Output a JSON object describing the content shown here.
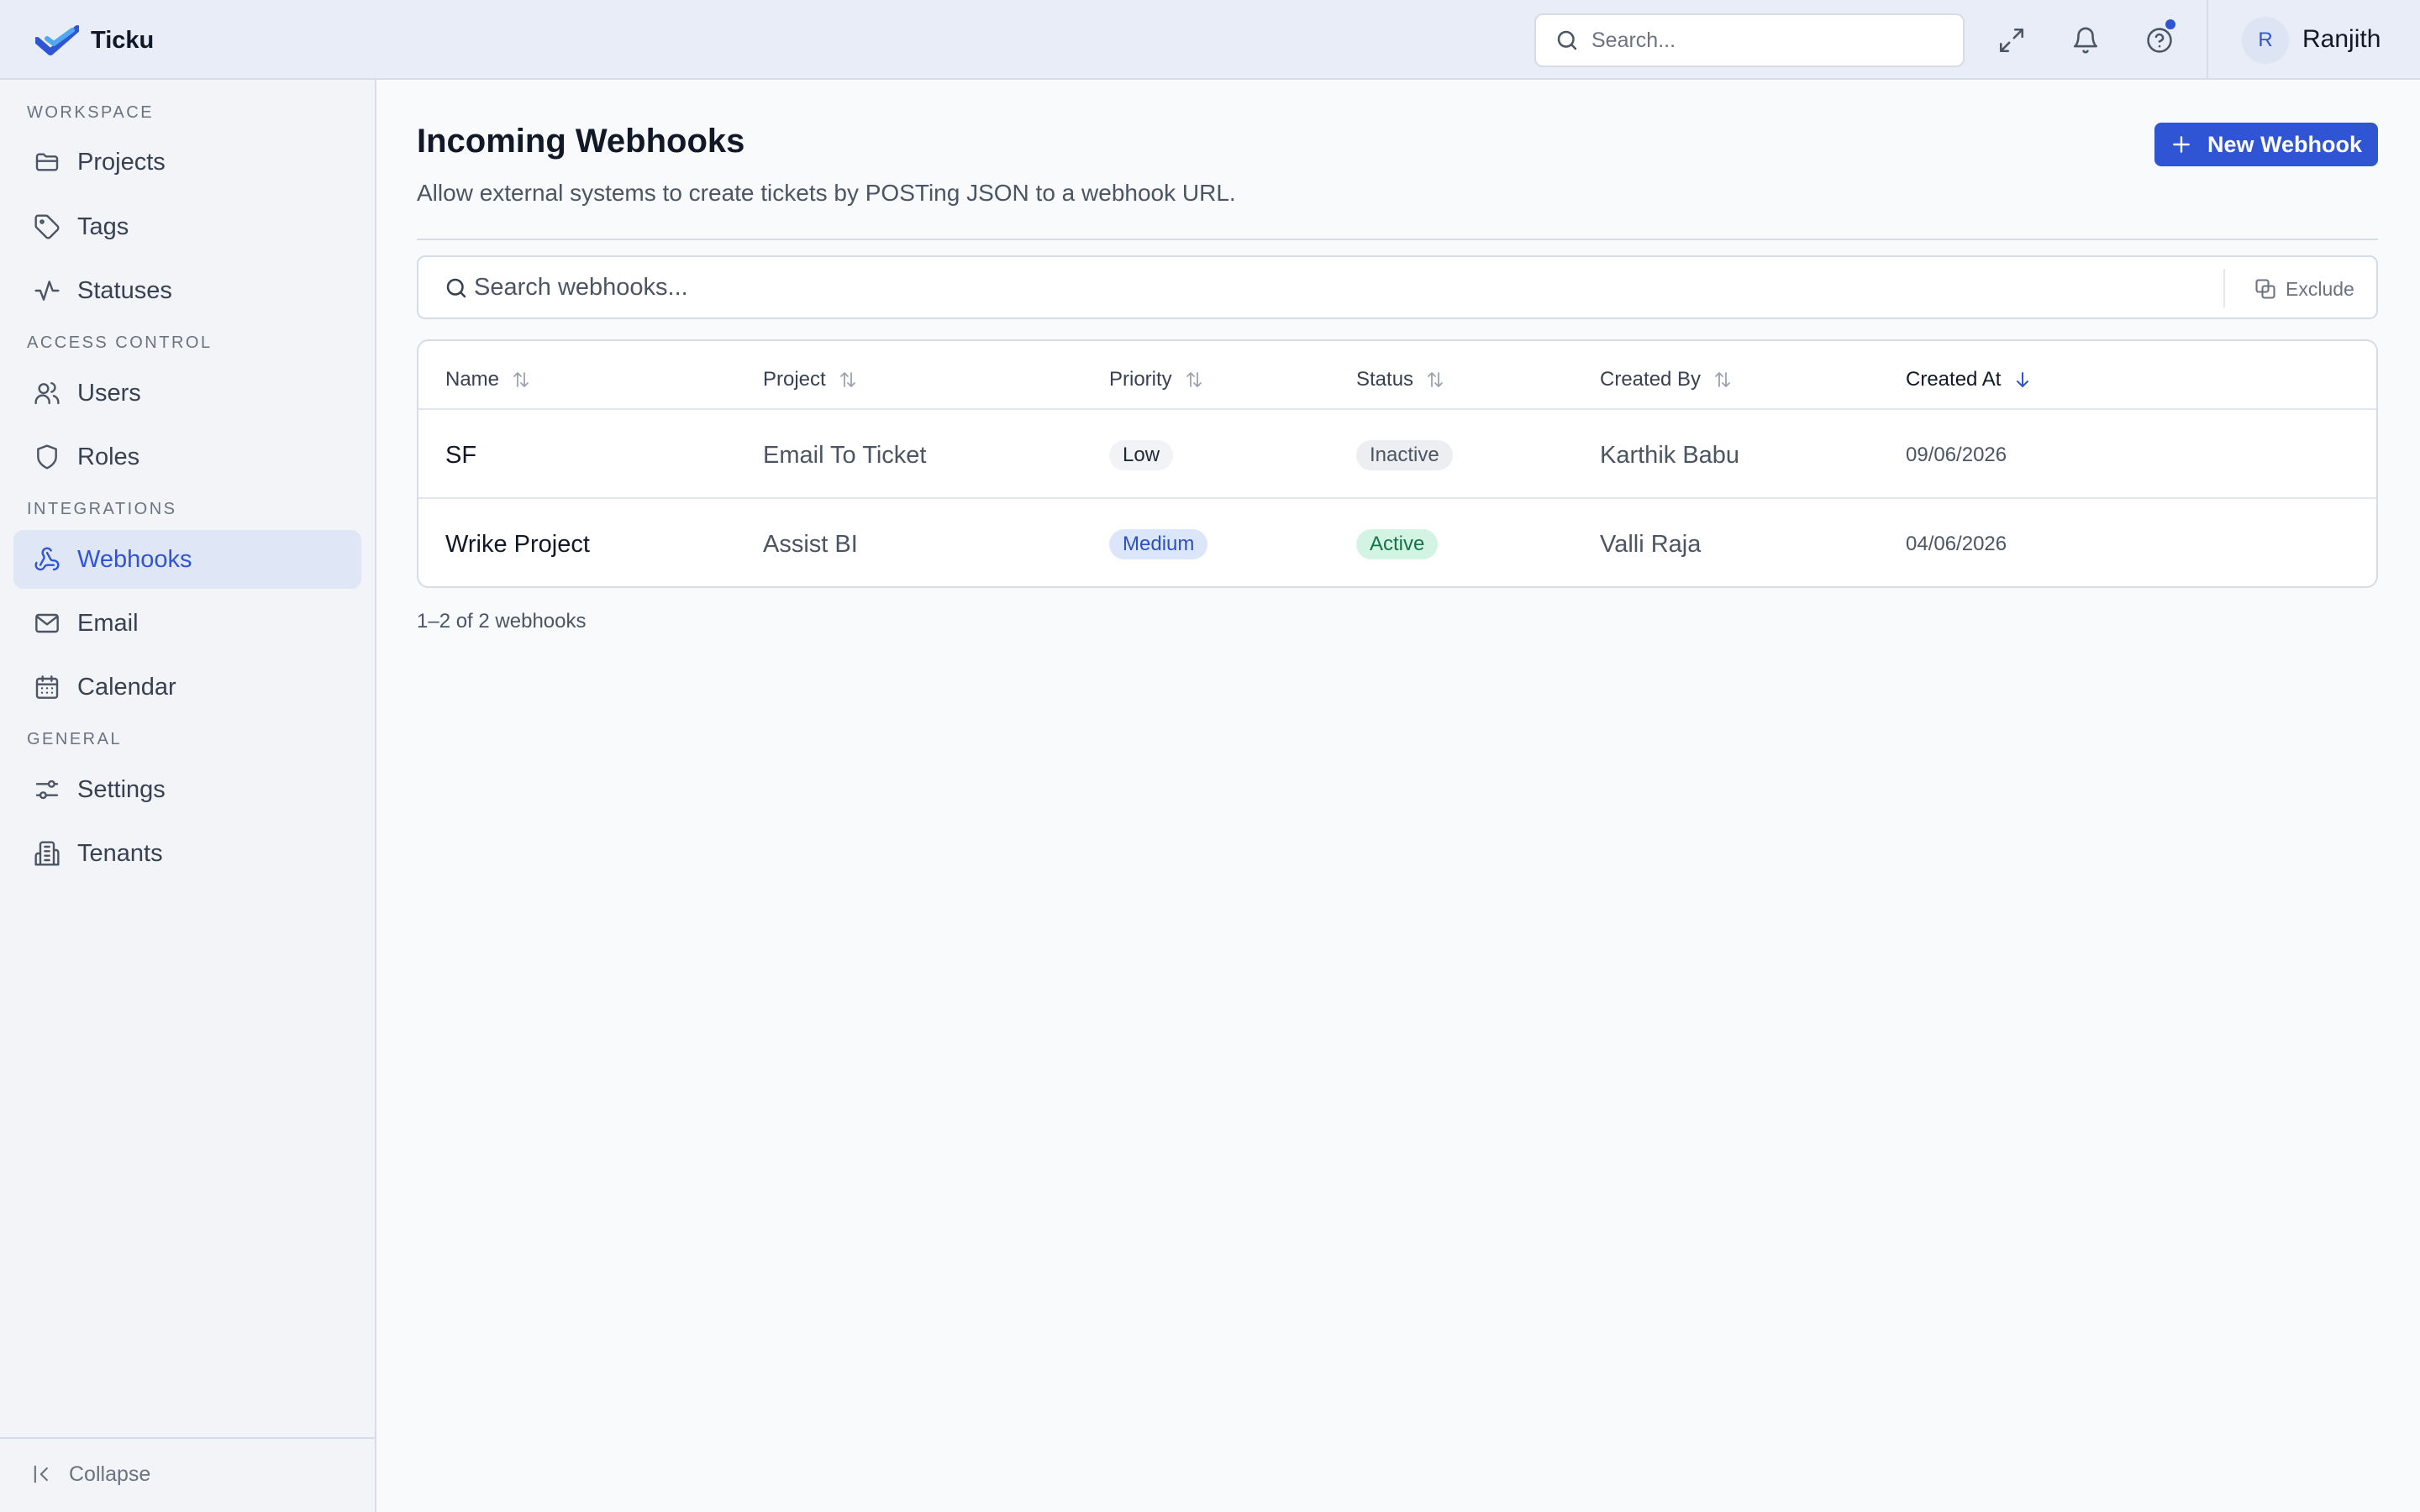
{
  "app": {
    "name": "Ticku",
    "search_placeholder": "Search...",
    "user": {
      "initial": "R",
      "name": "Ranjith"
    },
    "icons": [
      "expand-icon",
      "bell-icon",
      "help-icon"
    ],
    "accent_color": "#2f55d4"
  },
  "sidebar": {
    "sections": [
      {
        "label": "WORKSPACE",
        "items": [
          {
            "label": "Projects",
            "icon": "folder-icon"
          },
          {
            "label": "Tags",
            "icon": "tag-icon"
          },
          {
            "label": "Statuses",
            "icon": "activity-icon"
          }
        ]
      },
      {
        "label": "ACCESS CONTROL",
        "items": [
          {
            "label": "Users",
            "icon": "users-icon"
          },
          {
            "label": "Roles",
            "icon": "shield-icon"
          }
        ]
      },
      {
        "label": "INTEGRATIONS",
        "items": [
          {
            "label": "Webhooks",
            "icon": "webhook-icon",
            "active": true
          },
          {
            "label": "Email",
            "icon": "mail-icon"
          },
          {
            "label": "Calendar",
            "icon": "calendar-icon"
          }
        ]
      },
      {
        "label": "GENERAL",
        "items": [
          {
            "label": "Settings",
            "icon": "sliders-icon"
          },
          {
            "label": "Tenants",
            "icon": "building-icon"
          }
        ]
      }
    ],
    "collapse_label": "Collapse"
  },
  "main": {
    "title": "Incoming Webhooks",
    "subtitle": "Allow external systems to create tickets by POSTing JSON to a webhook URL.",
    "new_button_label": "New Webhook",
    "search_placeholder": "Search webhooks...",
    "exclude_label": "Exclude",
    "table": {
      "columns": [
        "Name",
        "Project",
        "Priority",
        "Status",
        "Created By",
        "Created At"
      ],
      "sorted_column": "Created At",
      "sort_direction": "desc",
      "rows": [
        {
          "name": "SF",
          "project": "Email To Ticket",
          "priority": "Low",
          "status": "Inactive",
          "created_by": "Karthik Babu",
          "created_at": "09/06/2026"
        },
        {
          "name": "Wrike Project",
          "project": "Assist BI",
          "priority": "Medium",
          "status": "Active",
          "created_by": "Valli Raja",
          "created_at": "04/06/2026"
        }
      ]
    },
    "count_text": "1–2 of 2 webhooks"
  }
}
